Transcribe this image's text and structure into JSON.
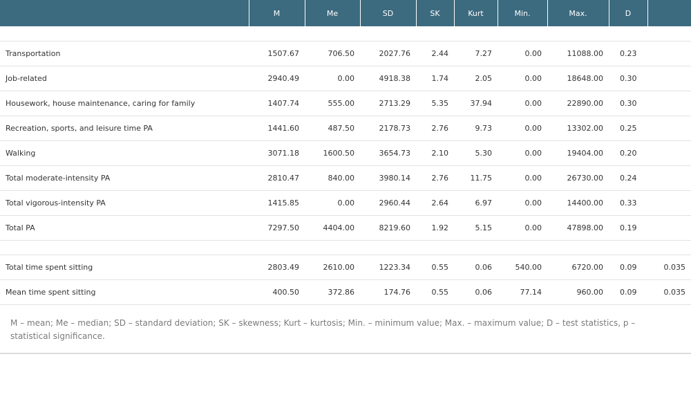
{
  "table": {
    "headers": [
      "",
      "M",
      "Me",
      "SD",
      "SK",
      "Kurt",
      "Min.",
      "Max.",
      "D",
      ""
    ],
    "groups": [
      {
        "rows": [
          {
            "label": "Transportation",
            "values": [
              "1507.67",
              "706.50",
              "2027.76",
              "2.44",
              "7.27",
              "0.00",
              "11088.00",
              "0.23",
              ""
            ]
          },
          {
            "label": "Job-related",
            "values": [
              "2940.49",
              "0.00",
              "4918.38",
              "1.74",
              "2.05",
              "0.00",
              "18648.00",
              "0.30",
              ""
            ]
          },
          {
            "label": "Housework, house maintenance, caring for family",
            "values": [
              "1407.74",
              "555.00",
              "2713.29",
              "5.35",
              "37.94",
              "0.00",
              "22890.00",
              "0.30",
              ""
            ]
          },
          {
            "label": "Recreation, sports, and leisure time PA",
            "values": [
              "1441.60",
              "487.50",
              "2178.73",
              "2.76",
              "9.73",
              "0.00",
              "13302.00",
              "0.25",
              ""
            ]
          },
          {
            "label": "Walking",
            "values": [
              "3071.18",
              "1600.50",
              "3654.73",
              "2.10",
              "5.30",
              "0.00",
              "19404.00",
              "0.20",
              ""
            ]
          },
          {
            "label": "Total moderate-intensity PA",
            "values": [
              "2810.47",
              "840.00",
              "3980.14",
              "2.76",
              "11.75",
              "0.00",
              "26730.00",
              "0.24",
              ""
            ]
          },
          {
            "label": "Total vigorous-intensity PA",
            "values": [
              "1415.85",
              "0.00",
              "2960.44",
              "2.64",
              "6.97",
              "0.00",
              "14400.00",
              "0.33",
              ""
            ]
          },
          {
            "label": "Total PA",
            "values": [
              "7297.50",
              "4404.00",
              "8219.60",
              "1.92",
              "5.15",
              "0.00",
              "47898.00",
              "0.19",
              ""
            ]
          }
        ]
      },
      {
        "rows": [
          {
            "label": "Total time spent sitting",
            "values": [
              "2803.49",
              "2610.00",
              "1223.34",
              "0.55",
              "0.06",
              "540.00",
              "6720.00",
              "0.09",
              "0.035"
            ]
          },
          {
            "label": "Mean time spent sitting",
            "values": [
              "400.50",
              "372.86",
              "174.76",
              "0.55",
              "0.06",
              "77.14",
              "960.00",
              "0.09",
              "0.035"
            ]
          }
        ]
      }
    ]
  },
  "footnote": "M – mean; Me – median; SD – standard deviation; SK – skewness; Kurt – kurtosis; Min. – minimum value; Max. – maximum value; D – test statistics, p – statistical significance."
}
